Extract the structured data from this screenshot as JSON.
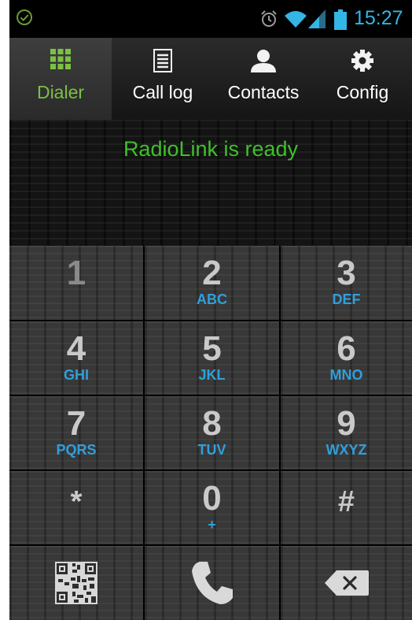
{
  "status_bar": {
    "time": "15:27",
    "icons": [
      "check-circle-icon",
      "alarm-icon",
      "wifi-icon",
      "signal-icon",
      "battery-icon"
    ]
  },
  "tabs": [
    {
      "label": "Dialer",
      "icon": "keypad-grid-icon",
      "active": true
    },
    {
      "label": "Call log",
      "icon": "list-icon",
      "active": false
    },
    {
      "label": "Contacts",
      "icon": "person-icon",
      "active": false
    },
    {
      "label": "Config",
      "icon": "gear-icon",
      "active": false
    }
  ],
  "display": {
    "status_text": "RadioLink is ready"
  },
  "keypad": {
    "keys": [
      {
        "digit": "1",
        "letters": ""
      },
      {
        "digit": "2",
        "letters": "ABC"
      },
      {
        "digit": "3",
        "letters": "DEF"
      },
      {
        "digit": "4",
        "letters": "GHI"
      },
      {
        "digit": "5",
        "letters": "JKL"
      },
      {
        "digit": "6",
        "letters": "MNO"
      },
      {
        "digit": "7",
        "letters": "PQRS"
      },
      {
        "digit": "8",
        "letters": "TUV"
      },
      {
        "digit": "9",
        "letters": "WXYZ"
      },
      {
        "digit": "*",
        "letters": ""
      },
      {
        "digit": "0",
        "letters": "+"
      },
      {
        "digit": "#",
        "letters": ""
      }
    ],
    "bottom_row": [
      "qr-code-icon",
      "phone-call-icon",
      "backspace-icon"
    ]
  },
  "colors": {
    "accent_green": "#7bc142",
    "status_green": "#3ec12a",
    "letters_blue": "#2f9fdc",
    "statusbar_blue": "#33b5e5"
  }
}
